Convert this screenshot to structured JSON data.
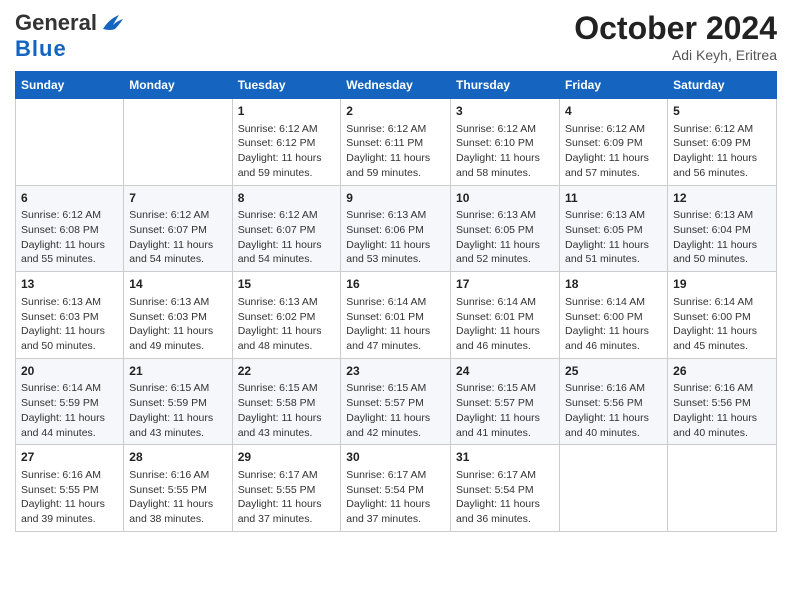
{
  "header": {
    "logo_general": "General",
    "logo_blue": "Blue",
    "month": "October 2024",
    "location": "Adi Keyh, Eritrea"
  },
  "days_of_week": [
    "Sunday",
    "Monday",
    "Tuesday",
    "Wednesday",
    "Thursday",
    "Friday",
    "Saturday"
  ],
  "weeks": [
    [
      {
        "day": "",
        "info": ""
      },
      {
        "day": "",
        "info": ""
      },
      {
        "day": "1",
        "info": "Sunrise: 6:12 AM\nSunset: 6:12 PM\nDaylight: 11 hours and 59 minutes."
      },
      {
        "day": "2",
        "info": "Sunrise: 6:12 AM\nSunset: 6:11 PM\nDaylight: 11 hours and 59 minutes."
      },
      {
        "day": "3",
        "info": "Sunrise: 6:12 AM\nSunset: 6:10 PM\nDaylight: 11 hours and 58 minutes."
      },
      {
        "day": "4",
        "info": "Sunrise: 6:12 AM\nSunset: 6:09 PM\nDaylight: 11 hours and 57 minutes."
      },
      {
        "day": "5",
        "info": "Sunrise: 6:12 AM\nSunset: 6:09 PM\nDaylight: 11 hours and 56 minutes."
      }
    ],
    [
      {
        "day": "6",
        "info": "Sunrise: 6:12 AM\nSunset: 6:08 PM\nDaylight: 11 hours and 55 minutes."
      },
      {
        "day": "7",
        "info": "Sunrise: 6:12 AM\nSunset: 6:07 PM\nDaylight: 11 hours and 54 minutes."
      },
      {
        "day": "8",
        "info": "Sunrise: 6:12 AM\nSunset: 6:07 PM\nDaylight: 11 hours and 54 minutes."
      },
      {
        "day": "9",
        "info": "Sunrise: 6:13 AM\nSunset: 6:06 PM\nDaylight: 11 hours and 53 minutes."
      },
      {
        "day": "10",
        "info": "Sunrise: 6:13 AM\nSunset: 6:05 PM\nDaylight: 11 hours and 52 minutes."
      },
      {
        "day": "11",
        "info": "Sunrise: 6:13 AM\nSunset: 6:05 PM\nDaylight: 11 hours and 51 minutes."
      },
      {
        "day": "12",
        "info": "Sunrise: 6:13 AM\nSunset: 6:04 PM\nDaylight: 11 hours and 50 minutes."
      }
    ],
    [
      {
        "day": "13",
        "info": "Sunrise: 6:13 AM\nSunset: 6:03 PM\nDaylight: 11 hours and 50 minutes."
      },
      {
        "day": "14",
        "info": "Sunrise: 6:13 AM\nSunset: 6:03 PM\nDaylight: 11 hours and 49 minutes."
      },
      {
        "day": "15",
        "info": "Sunrise: 6:13 AM\nSunset: 6:02 PM\nDaylight: 11 hours and 48 minutes."
      },
      {
        "day": "16",
        "info": "Sunrise: 6:14 AM\nSunset: 6:01 PM\nDaylight: 11 hours and 47 minutes."
      },
      {
        "day": "17",
        "info": "Sunrise: 6:14 AM\nSunset: 6:01 PM\nDaylight: 11 hours and 46 minutes."
      },
      {
        "day": "18",
        "info": "Sunrise: 6:14 AM\nSunset: 6:00 PM\nDaylight: 11 hours and 46 minutes."
      },
      {
        "day": "19",
        "info": "Sunrise: 6:14 AM\nSunset: 6:00 PM\nDaylight: 11 hours and 45 minutes."
      }
    ],
    [
      {
        "day": "20",
        "info": "Sunrise: 6:14 AM\nSunset: 5:59 PM\nDaylight: 11 hours and 44 minutes."
      },
      {
        "day": "21",
        "info": "Sunrise: 6:15 AM\nSunset: 5:59 PM\nDaylight: 11 hours and 43 minutes."
      },
      {
        "day": "22",
        "info": "Sunrise: 6:15 AM\nSunset: 5:58 PM\nDaylight: 11 hours and 43 minutes."
      },
      {
        "day": "23",
        "info": "Sunrise: 6:15 AM\nSunset: 5:57 PM\nDaylight: 11 hours and 42 minutes."
      },
      {
        "day": "24",
        "info": "Sunrise: 6:15 AM\nSunset: 5:57 PM\nDaylight: 11 hours and 41 minutes."
      },
      {
        "day": "25",
        "info": "Sunrise: 6:16 AM\nSunset: 5:56 PM\nDaylight: 11 hours and 40 minutes."
      },
      {
        "day": "26",
        "info": "Sunrise: 6:16 AM\nSunset: 5:56 PM\nDaylight: 11 hours and 40 minutes."
      }
    ],
    [
      {
        "day": "27",
        "info": "Sunrise: 6:16 AM\nSunset: 5:55 PM\nDaylight: 11 hours and 39 minutes."
      },
      {
        "day": "28",
        "info": "Sunrise: 6:16 AM\nSunset: 5:55 PM\nDaylight: 11 hours and 38 minutes."
      },
      {
        "day": "29",
        "info": "Sunrise: 6:17 AM\nSunset: 5:55 PM\nDaylight: 11 hours and 37 minutes."
      },
      {
        "day": "30",
        "info": "Sunrise: 6:17 AM\nSunset: 5:54 PM\nDaylight: 11 hours and 37 minutes."
      },
      {
        "day": "31",
        "info": "Sunrise: 6:17 AM\nSunset: 5:54 PM\nDaylight: 11 hours and 36 minutes."
      },
      {
        "day": "",
        "info": ""
      },
      {
        "day": "",
        "info": ""
      }
    ]
  ]
}
